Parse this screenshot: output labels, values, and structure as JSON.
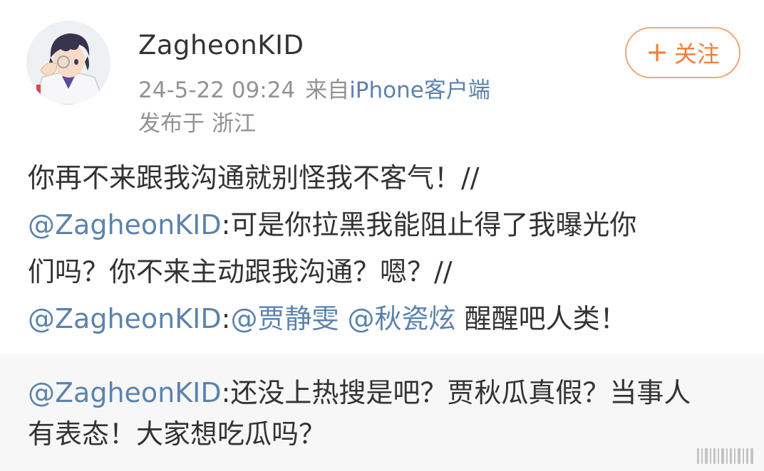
{
  "post": {
    "author": {
      "username": "ZagheonKID"
    },
    "meta": {
      "timestamp": "24-5-22 09:24",
      "source_prefix": "来自",
      "source": "iPhone客户端",
      "location_prefix": "发布于",
      "location": "浙江"
    },
    "follow_button": {
      "icon": "+",
      "label": "关注"
    },
    "content": {
      "line1": "你再不来跟我沟通就别怪我不客气！//",
      "line2_mention": "@ZagheonKID",
      "line2_text": ":可是你拉黑我能阻止得了我曝光你",
      "line3": "们吗？你不来主动跟我沟通？嗯？//",
      "line4_mention": "@ZagheonKID",
      "line4_colon": ":",
      "line4_mention2": "@贾静雯",
      "line4_mention3": "@秋瓷炫",
      "line4_text": "醒醒吧人类！"
    }
  },
  "retweet": {
    "mention": "@ZagheonKID",
    "line1_text": ":还没上热搜是吧？贾秋瓜真假？当事人",
    "line2": "有表态！大家想吃瓜吗？"
  },
  "colors": {
    "link": "#5b83ad",
    "text": "#333333",
    "muted": "#939393",
    "follow": "#f07e3a",
    "retweet_bg": "#f7f7f7"
  },
  "icons": {
    "avatar": "anime-character-avatar",
    "watermark": "barcode-watermark-icon"
  }
}
